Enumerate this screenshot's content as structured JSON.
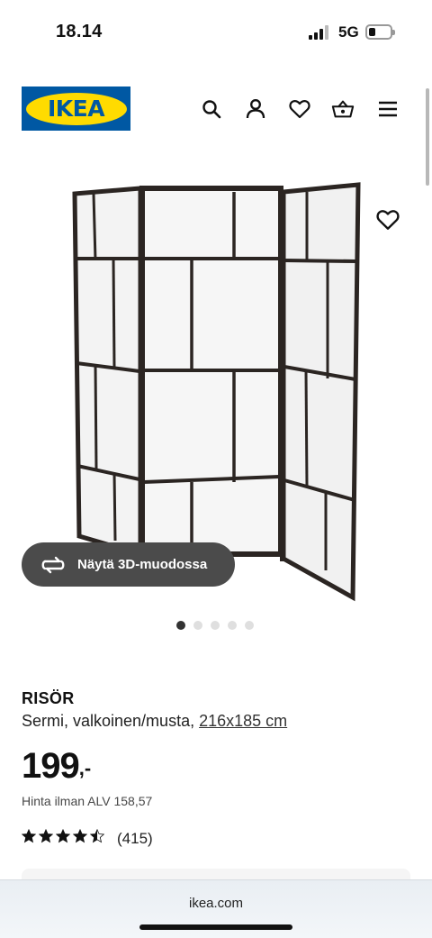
{
  "status_bar": {
    "time": "18.14",
    "network": "5G"
  },
  "header": {
    "logo_text": "IKEA",
    "icons": [
      "search-icon",
      "account-icon",
      "heart-icon",
      "basket-icon",
      "menu-icon"
    ]
  },
  "gallery": {
    "view_3d_label": "Näytä 3D-muodossa",
    "image_count": 5,
    "active_index": 0
  },
  "product": {
    "name": "RISÖR",
    "description": "Sermi, valkoinen/musta,",
    "dimensions": "216x185 cm",
    "price_amount": "199",
    "price_suffix": ",-",
    "vat_note": "Hinta ilman ALV 158,57",
    "rating_value": 4.5,
    "review_count": "(415)"
  },
  "browser": {
    "url": "ikea.com"
  },
  "colors": {
    "ikea_blue": "#0058a3",
    "ikea_yellow": "#ffdb00",
    "button_dark": "#4b4b4b"
  }
}
